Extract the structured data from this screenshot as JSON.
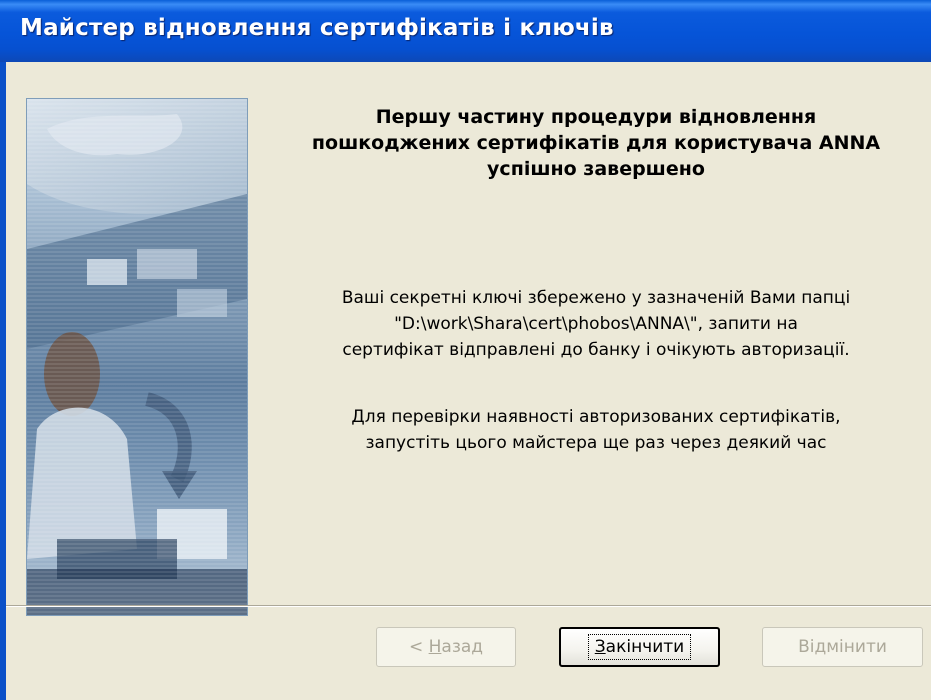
{
  "window": {
    "title": "Майстер відновлення сертифікатів і ключів"
  },
  "heading": {
    "line1": "Першу частину процедури відновлення",
    "line2": "пошкоджених сертифікатів для користувача ANNA",
    "line3": "успішно завершено"
  },
  "message": {
    "line1": "Ваші секретні ключі збережено у зазначеній Вами папці",
    "line2": "\"D:\\work\\Shara\\cert\\phobos\\ANNA\\\", запити на",
    "line3": "сертифікат відправлені до банку і очікують авторизації."
  },
  "hint": {
    "line1": "Для перевірки наявності авторизованих сертифікатів,",
    "line2": "запустіть цього майстера ще раз через деякий час"
  },
  "buttons": {
    "back": {
      "prefix": "< ",
      "accel": "Н",
      "rest": "азад",
      "enabled": false
    },
    "finish": {
      "accel": "З",
      "rest": "акінчити",
      "enabled": true
    },
    "cancel": {
      "label": "Відмінити",
      "enabled": false
    }
  },
  "colors": {
    "titlebar": "#0654d8",
    "dialog_bg": "#ece9d8",
    "disabled_text": "#aca899"
  },
  "icons": {
    "side_image": "wizard-side-illustration"
  }
}
